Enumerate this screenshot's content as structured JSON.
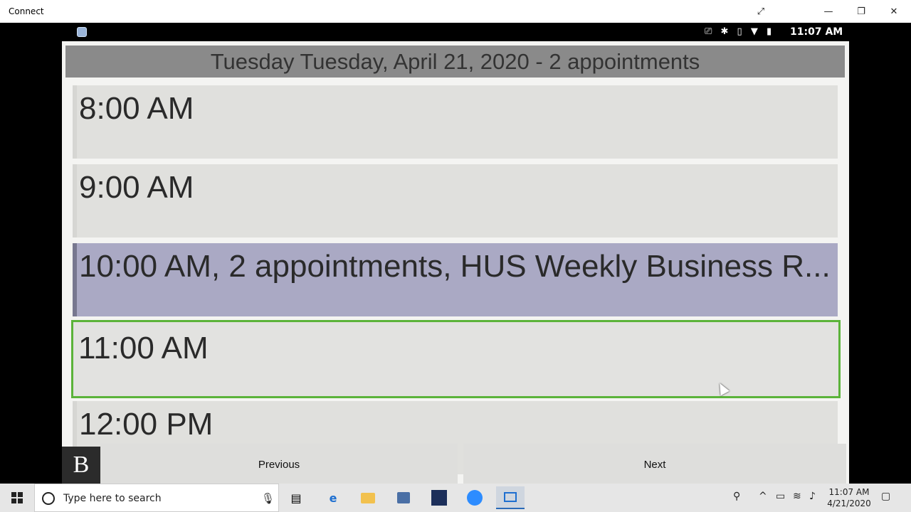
{
  "window": {
    "title": "Connect",
    "expand_glyph": "⤢",
    "minimize_glyph": "—",
    "restore_glyph": "❐",
    "close_glyph": "✕"
  },
  "status_bar": {
    "icons": "⎚ ✱ ▯ ▼ ▮",
    "time": "11:07 AM"
  },
  "calendar": {
    "header": "Tuesday Tuesday, April 21, 2020 - 2 appointments",
    "slots": [
      {
        "label": "8:00 AM",
        "state": "free"
      },
      {
        "label": "9:00 AM",
        "state": "free"
      },
      {
        "label": "10:00 AM, 2 appointments, HUS Weekly Business R...",
        "state": "busy"
      },
      {
        "label": "11:00 AM",
        "state": "selected"
      },
      {
        "label": "12:00 PM",
        "state": "free"
      }
    ],
    "colors": {
      "busy": "#aaa9c4",
      "selected_border": "#5bb33a"
    }
  },
  "nav": {
    "logo_letter": "B",
    "previous": "Previous",
    "next": "Next"
  },
  "taskbar": {
    "search_placeholder": "Type here to search",
    "mic_glyph": "🎙",
    "apps": [
      "task-view-icon",
      "edge-icon",
      "file-explorer-icon",
      "store-icon",
      "app-icon",
      "zoom-icon",
      "connect-icon"
    ],
    "clock_time": "11:07 AM",
    "clock_date": "4/21/2020"
  }
}
